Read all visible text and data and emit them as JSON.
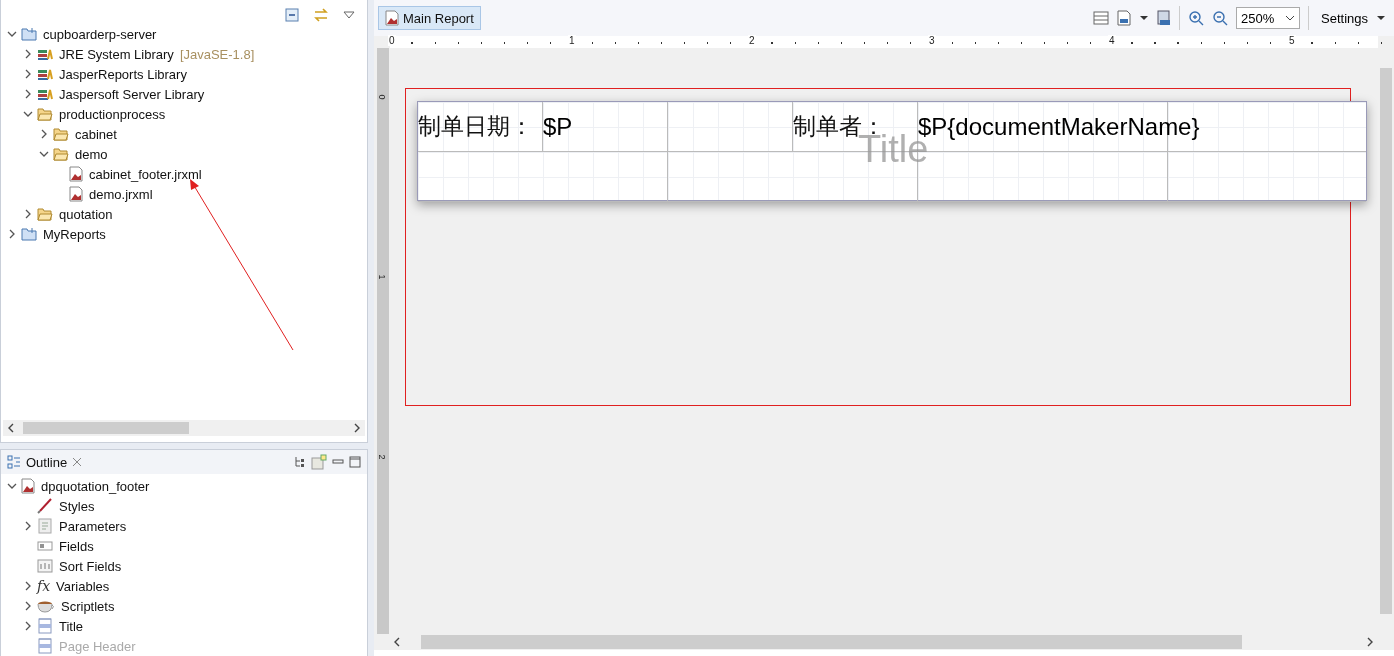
{
  "explorer": {
    "tree": [
      {
        "label": "cupboarderp-server",
        "kind": "project",
        "expanded": true,
        "children": [
          {
            "label": "JRE System Library",
            "note": "[JavaSE-1.8]",
            "kind": "library",
            "expanded": false
          },
          {
            "label": "JasperReports Library",
            "kind": "library",
            "expanded": false
          },
          {
            "label": "Jaspersoft Server Library",
            "kind": "library",
            "expanded": false
          },
          {
            "label": "productionprocess",
            "kind": "folder",
            "expanded": true,
            "children": [
              {
                "label": "cabinet",
                "kind": "folder",
                "expanded": false
              },
              {
                "label": "demo",
                "kind": "folder",
                "expanded": true,
                "children": [
                  {
                    "label": "cabinet_footer.jrxml",
                    "kind": "report"
                  },
                  {
                    "label": "demo.jrxml",
                    "kind": "report"
                  }
                ]
              }
            ]
          },
          {
            "label": "quotation",
            "kind": "folder",
            "expanded": false
          }
        ]
      },
      {
        "label": "MyReports",
        "kind": "project",
        "expanded": false
      }
    ]
  },
  "outline": {
    "title": "Outline",
    "tree": [
      {
        "label": "dpquotation_footer",
        "kind": "report",
        "expanded": true,
        "disabled": false,
        "children": [
          {
            "label": "Styles",
            "kind": "styles",
            "disabled": false
          },
          {
            "label": "Parameters",
            "kind": "parameters",
            "expanded": false,
            "disabled": false
          },
          {
            "label": "Fields",
            "kind": "fields",
            "disabled": false
          },
          {
            "label": "Sort Fields",
            "kind": "sort_fields",
            "disabled": false
          },
          {
            "label": "Variables",
            "kind": "variables",
            "glyph": "fx",
            "expanded": false,
            "disabled": false
          },
          {
            "label": "Scriptlets",
            "kind": "scriptlets",
            "expanded": false,
            "disabled": false
          },
          {
            "label": "Title",
            "kind": "band",
            "expanded": false,
            "disabled": false
          },
          {
            "label": "Page Header",
            "kind": "band",
            "disabled": true
          }
        ]
      }
    ]
  },
  "editor": {
    "tabs": [
      {
        "label": "Main Report",
        "selected": true
      }
    ],
    "zoom": "250%",
    "settings": "Settings",
    "ruler_h": [
      "0",
      "1",
      "2",
      "3",
      "4",
      "5"
    ],
    "ruler_v": [
      "0",
      "1",
      "2"
    ],
    "band": {
      "name": "Title",
      "rows": [
        {
          "cells": [
            {
              "kind": "static",
              "text": "制单日期："
            },
            {
              "kind": "field",
              "text": "$P"
            },
            {
              "kind": "empty"
            },
            {
              "kind": "static",
              "text": "制单者："
            },
            {
              "kind": "field",
              "text": "$P{documentMakerName}"
            },
            {
              "kind": "empty"
            }
          ]
        },
        {
          "cells": [
            {
              "kind": "empty"
            },
            {
              "kind": "empty"
            },
            {
              "kind": "empty"
            },
            {
              "kind": "empty"
            }
          ]
        }
      ]
    }
  }
}
